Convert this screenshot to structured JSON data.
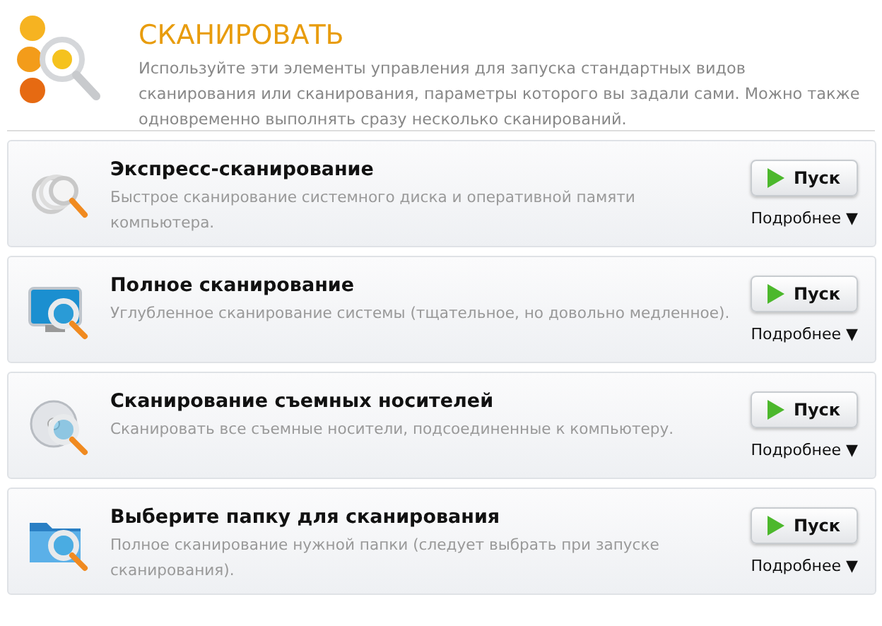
{
  "header": {
    "title": "СКАНИРОВАТЬ",
    "description": "Используйте эти элементы управления для запуска стандартных видов сканирования или сканирования, параметры которого вы задали сами. Можно также одновременно выполнять сразу несколько сканирований."
  },
  "scans": [
    {
      "kind": "quick",
      "title": "Экспресс-сканирование",
      "description": "Быстрое сканирование системного диска и оперативной памяти компьютера.",
      "button": "Пуск",
      "details": "Подробнее ▼"
    },
    {
      "kind": "full",
      "title": "Полное сканирование",
      "description": "Углубленное сканирование системы (тщательное, но довольно медленное).",
      "button": "Пуск",
      "details": "Подробнее ▼"
    },
    {
      "kind": "removable",
      "title": "Сканирование съемных носителей",
      "description": "Сканировать все съемные носители, подсоединенные к компьютеру.",
      "button": "Пуск",
      "details": "Подробнее ▼"
    },
    {
      "kind": "folder",
      "title": "Выберите папку для сканирования",
      "description": "Полное сканирование нужной папки (следует выбрать при запуске сканирования).",
      "button": "Пуск",
      "details": "Подробнее ▼"
    }
  ]
}
